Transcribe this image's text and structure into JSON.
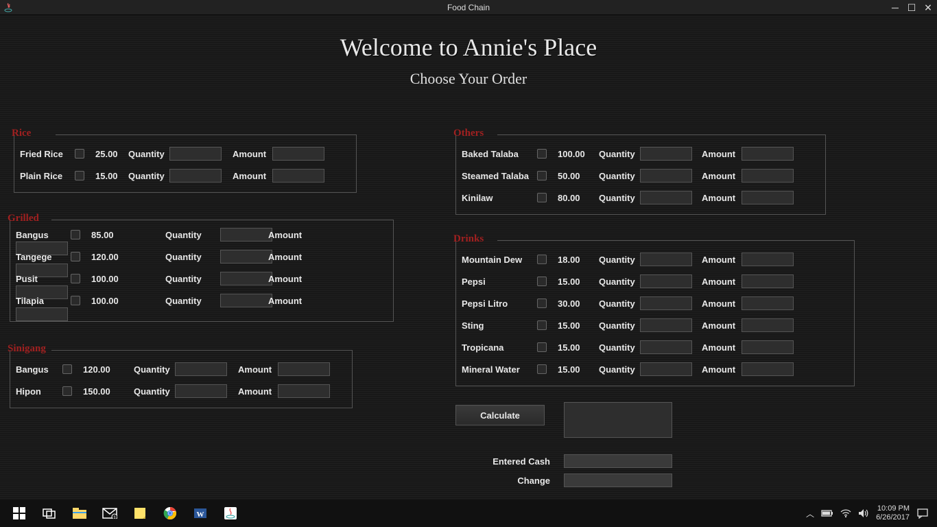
{
  "window": {
    "title": "Food Chain"
  },
  "header": {
    "welcome": "Welcome to Annie's Place",
    "choose": "Choose Your Order"
  },
  "labels": {
    "quantity": "Quantity",
    "amount": "Amount"
  },
  "groups": {
    "rice": {
      "title": "Rice",
      "items": [
        {
          "name": "Fried Rice",
          "price": "25.00"
        },
        {
          "name": "Plain Rice",
          "price": "15.00"
        }
      ]
    },
    "grilled": {
      "title": "Grilled",
      "items": [
        {
          "name": "Bangus",
          "price": "85.00"
        },
        {
          "name": "Tangege",
          "price": "120.00"
        },
        {
          "name": "Pusit",
          "price": "100.00"
        },
        {
          "name": "Tilapia",
          "price": "100.00"
        }
      ]
    },
    "sinigang": {
      "title": "Sinigang",
      "items": [
        {
          "name": "Bangus",
          "price": "120.00"
        },
        {
          "name": "Hipon",
          "price": "150.00"
        }
      ]
    },
    "others": {
      "title": "Others",
      "items": [
        {
          "name": "Baked Talaba",
          "price": "100.00"
        },
        {
          "name": "Steamed Talaba",
          "price": "50.00"
        },
        {
          "name": "Kinilaw",
          "price": "80.00"
        }
      ]
    },
    "drinks": {
      "title": "Drinks",
      "items": [
        {
          "name": "Mountain Dew",
          "price": "18.00"
        },
        {
          "name": "Pepsi",
          "price": "15.00"
        },
        {
          "name": "Pepsi Litro",
          "price": "30.00"
        },
        {
          "name": "Sting",
          "price": "15.00"
        },
        {
          "name": "Tropicana",
          "price": "15.00"
        },
        {
          "name": "Mineral Water",
          "price": "15.00"
        }
      ]
    }
  },
  "totals": {
    "calculate_label": "Calculate",
    "entered_cash_label": "Entered Cash",
    "change_label": "Change"
  },
  "system": {
    "time": "10:09 PM",
    "date": "6/26/2017"
  }
}
